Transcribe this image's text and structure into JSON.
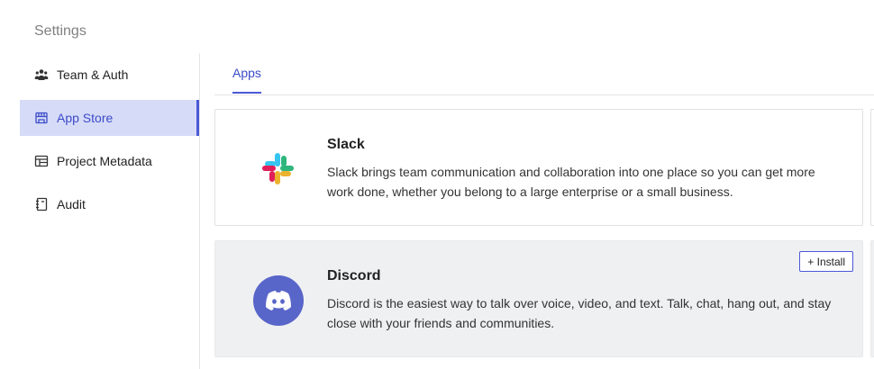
{
  "settings": {
    "title": "Settings"
  },
  "sidebar": {
    "items": [
      {
        "label": "Team & Auth",
        "icon": "team-icon"
      },
      {
        "label": "App Store",
        "icon": "store-icon",
        "active": true
      },
      {
        "label": "Project Metadata",
        "icon": "table-icon"
      },
      {
        "label": "Audit",
        "icon": "notebook-icon"
      }
    ]
  },
  "tabs": [
    {
      "label": "Apps",
      "active": true
    }
  ],
  "apps": [
    {
      "name": "Slack",
      "icon": "slack-icon",
      "description": "Slack brings team communication and collaboration into one place so you can get more work done, whether you belong to a large enterprise or a small business."
    },
    {
      "name": "Discord",
      "icon": "discord-icon",
      "description": "Discord is the easiest way to talk over voice, video, and text. Talk, chat, hang out, and stay close with your friends and communities.",
      "action_label": "+ Install"
    }
  ],
  "colors": {
    "accent": "#4b58d6",
    "active_bg": "#d6dbf7",
    "discord": "#5865c9"
  }
}
